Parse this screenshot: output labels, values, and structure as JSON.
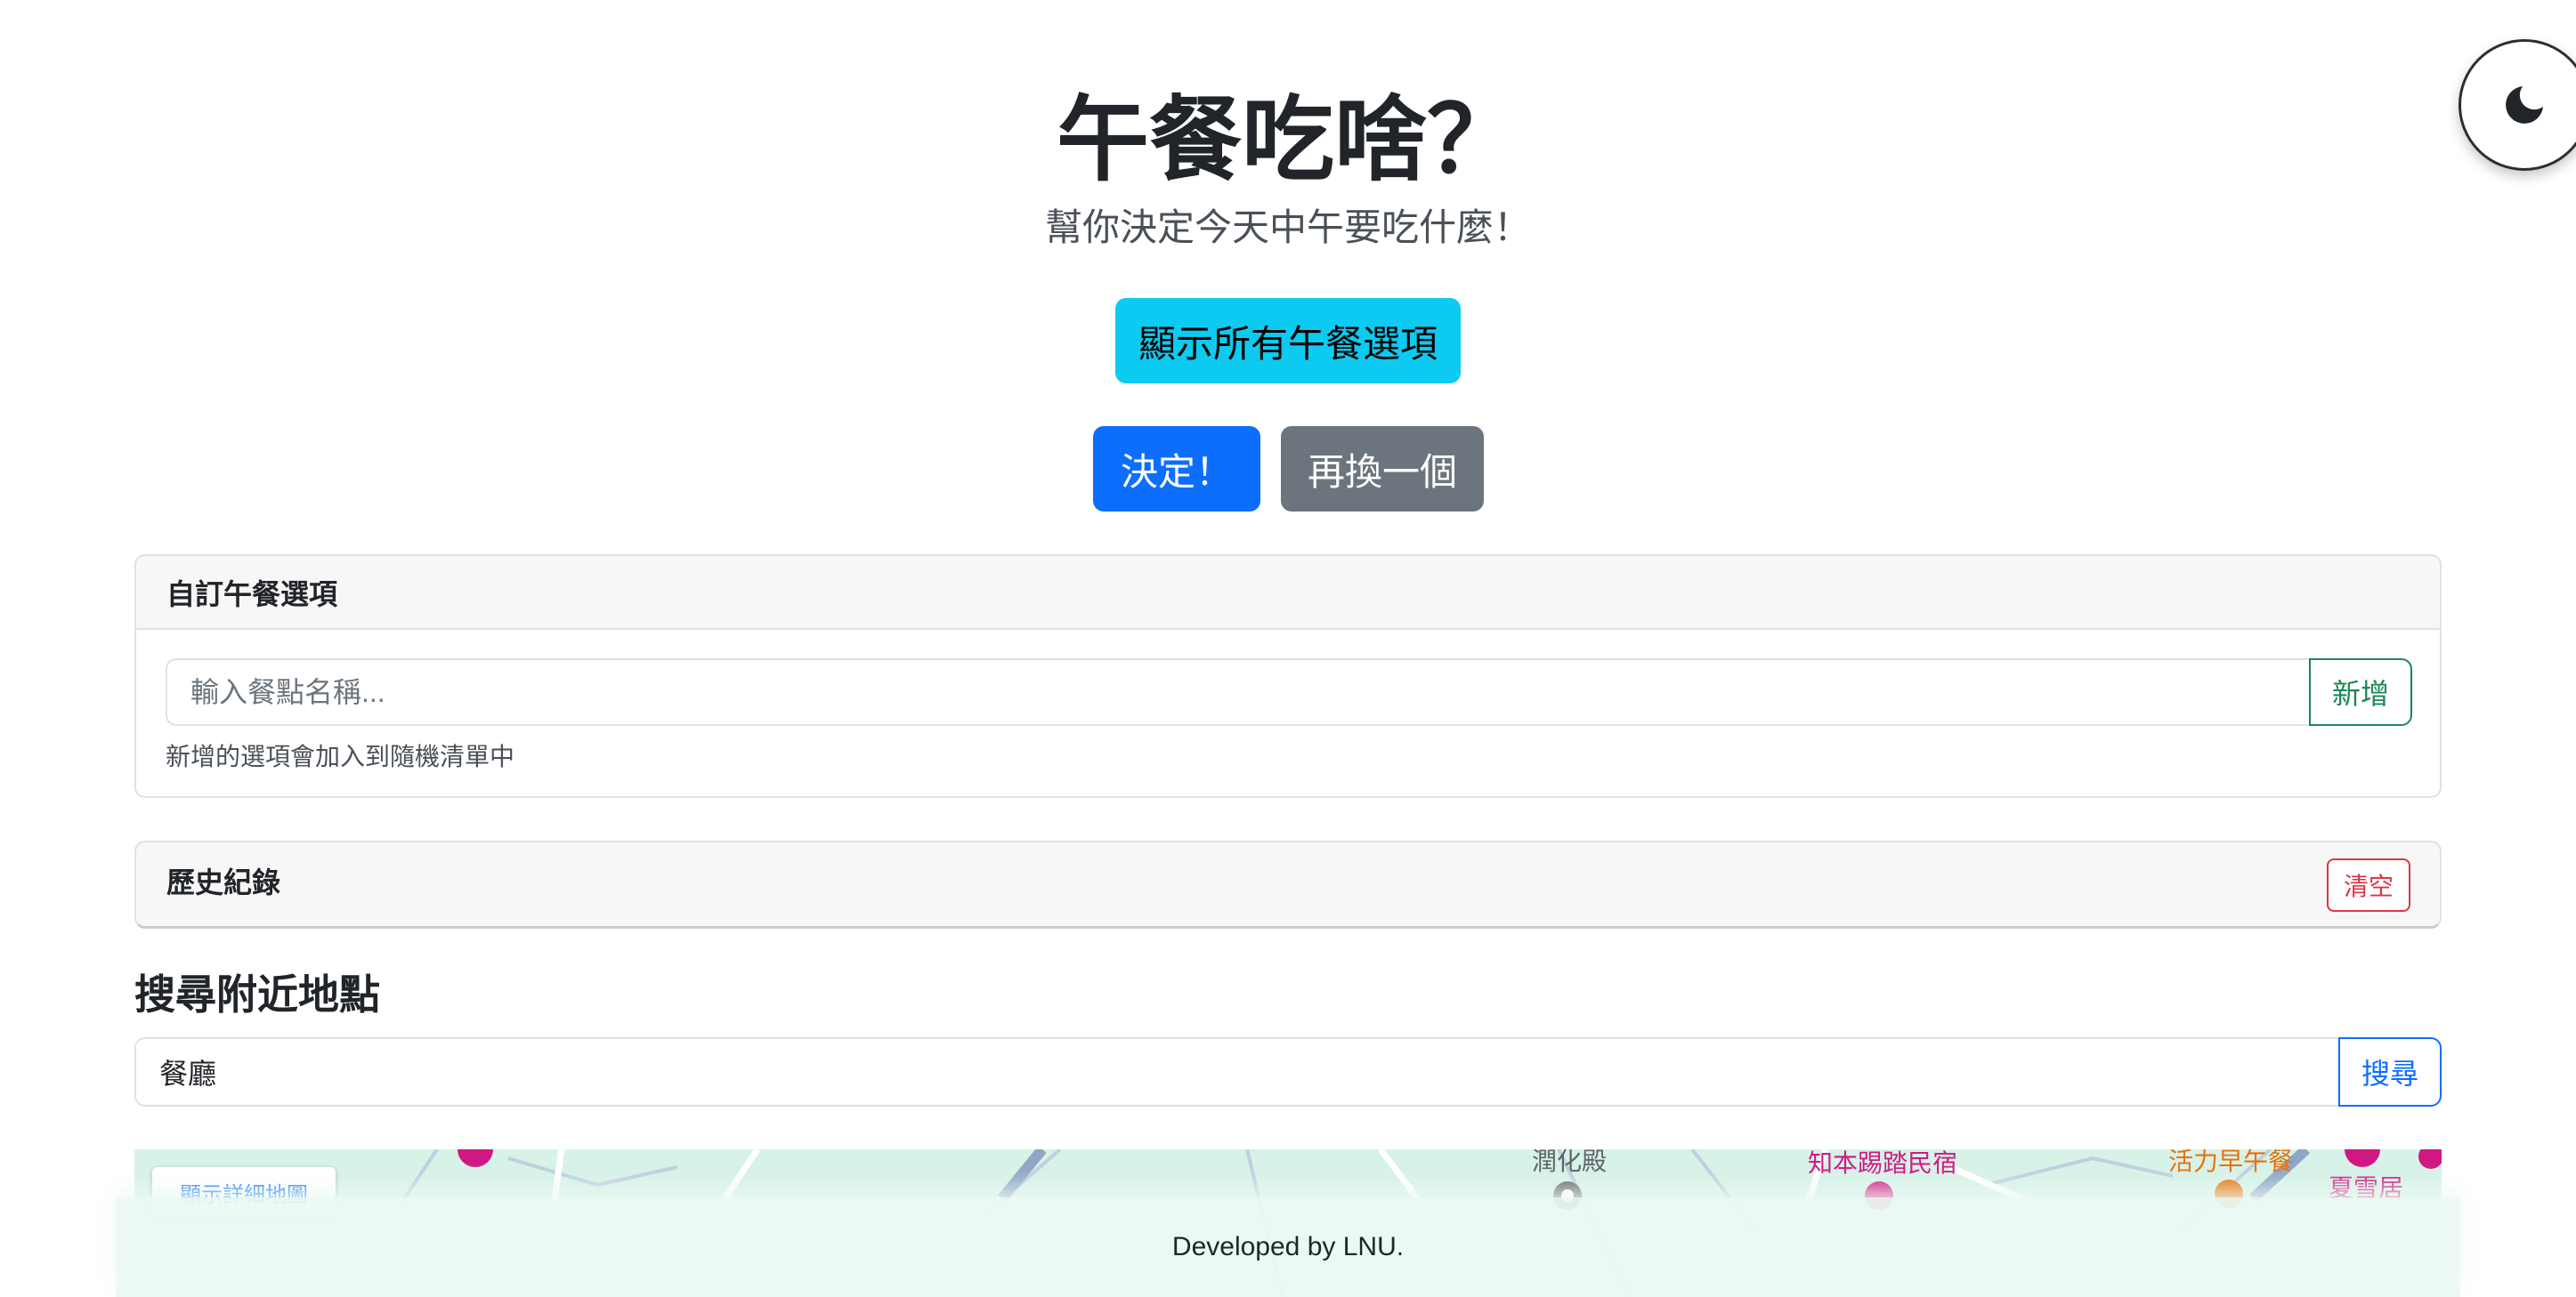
{
  "header": {
    "title": "午餐吃啥？",
    "subtitle": "幫你決定今天中午要吃什麼！"
  },
  "actions": {
    "show_all_label": "顯示所有午餐選項",
    "decide_label": "決定！",
    "another_label": "再換一個"
  },
  "custom_options": {
    "title": "自訂午餐選項",
    "input_placeholder": "輸入餐點名稱...",
    "input_value": "",
    "add_label": "新增",
    "help_text": "新增的選項會加入到隨機清單中"
  },
  "history": {
    "title": "歷史紀錄",
    "clear_label": "清空"
  },
  "nearby": {
    "title": "搜尋附近地點",
    "search_value": "餐廳",
    "search_label": "搜尋"
  },
  "map": {
    "detail_button_label": "顯示詳細地圖",
    "places": [
      {
        "name": "潤化殿",
        "color": "#5f6368"
      },
      {
        "name": "知本踢踏民宿",
        "color": "#d01884"
      },
      {
        "name": "活力早午餐",
        "color": "#e8710a"
      },
      {
        "name": "夏雪居",
        "color": "#d01884"
      }
    ],
    "land_color": "#d7f2e7",
    "road_color": "#ffffff"
  },
  "footer": {
    "text": "Developed by LNU."
  },
  "icons": {
    "theme_toggle": "moon-icon"
  },
  "colors": {
    "primary": "#0d6efd",
    "info": "#0dcaf0",
    "secondary": "#6c757d",
    "success": "#198754",
    "danger": "#dc3545"
  }
}
